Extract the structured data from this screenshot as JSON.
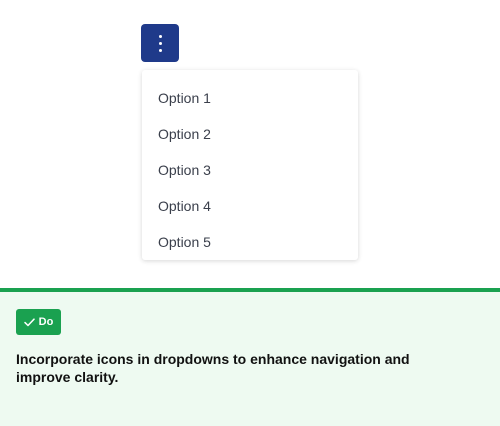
{
  "menu_button": {
    "icon": "more-vertical-icon",
    "background_color": "#1f3a8a"
  },
  "dropdown": {
    "items": [
      {
        "label": "Option 1"
      },
      {
        "label": "Option 2"
      },
      {
        "label": "Option 3"
      },
      {
        "label": "Option 4"
      },
      {
        "label": "Option 5"
      }
    ]
  },
  "guideline": {
    "badge": {
      "icon": "check-icon",
      "label": "Do",
      "color": "#1aa150"
    },
    "text": "Incorporate icons in dropdowns to enhance navigation and improve clarity.",
    "background_color": "#eefaf1"
  }
}
